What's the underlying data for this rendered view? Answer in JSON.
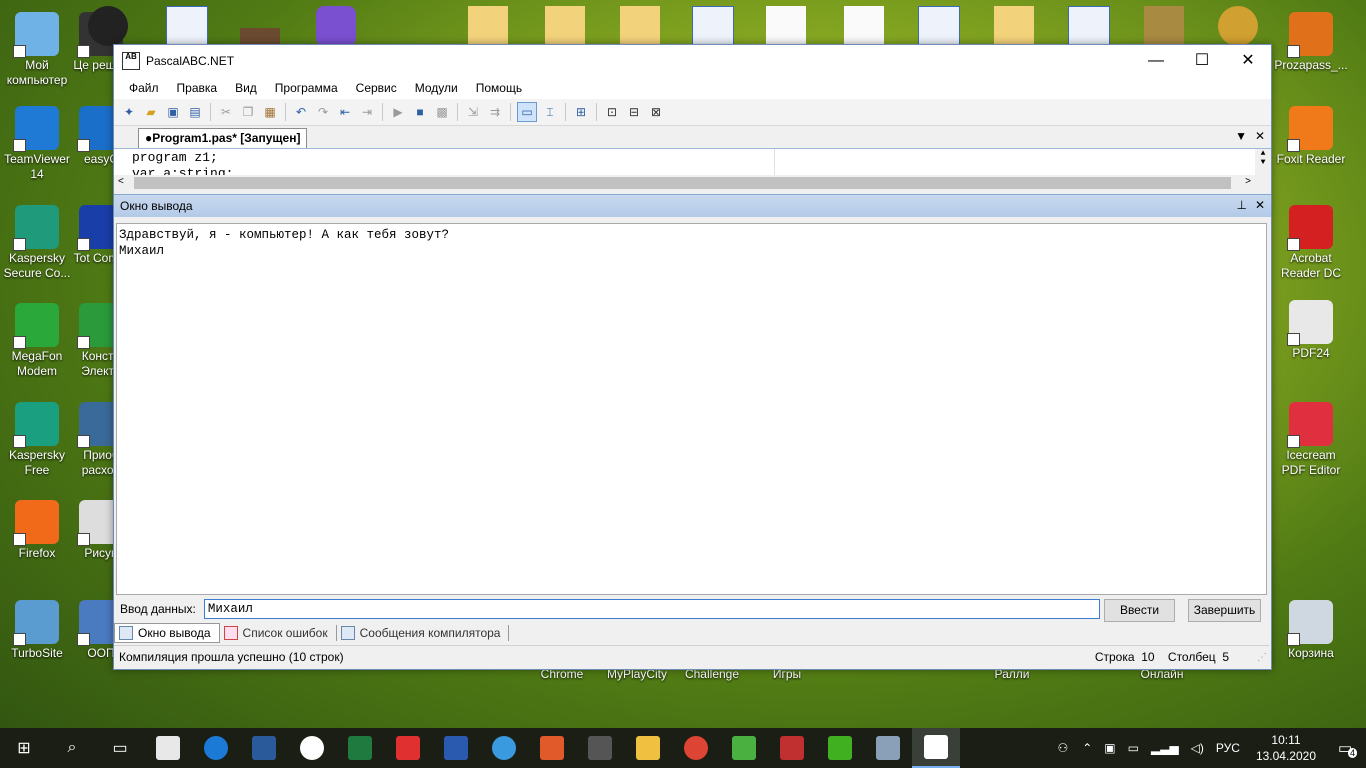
{
  "desktop": {
    "left_icons": [
      {
        "label": "Мой компьютер",
        "color": "#6fb3e6"
      },
      {
        "label": "TeamViewer 14",
        "color": "#1f7ad6"
      },
      {
        "label": "Kaspersky Secure Co...",
        "color": "#1f9a7a"
      },
      {
        "label": "MegaFon Modem",
        "color": "#2aa83a"
      },
      {
        "label": "Kaspersky Free",
        "color": "#1aa080"
      },
      {
        "label": "Firefox",
        "color": "#f06a1a"
      },
      {
        "label": "TurboSite",
        "color": "#5a9bd0"
      }
    ],
    "col2_icons": [
      {
        "label": "Це решен",
        "color": "#333333"
      },
      {
        "label": "easyC",
        "color": "#1a6fc9"
      },
      {
        "label": "Tot Comm",
        "color": "#1a3ea8"
      },
      {
        "label": "Констр Электр",
        "color": "#2a9a3a"
      },
      {
        "label": "Приоб расход",
        "color": "#3a6a9a"
      },
      {
        "label": "Рисун",
        "color": "#dddddd"
      },
      {
        "label": "ООП",
        "color": "#4a7ac0"
      }
    ],
    "right_icons": [
      {
        "label": "Prozapass_...",
        "color": "#e0701a"
      },
      {
        "label": "Foxit Reader",
        "color": "#f07a1a"
      },
      {
        "label": "Acrobat Reader DC",
        "color": "#d42020"
      },
      {
        "label": "PDF24",
        "color": "#e8e8e8"
      },
      {
        "label": "Icecream PDF Editor",
        "color": "#e03040"
      },
      {
        "label": "Корзина",
        "color": "#cfd8e0"
      }
    ],
    "bottom_labels": [
      "Chrome",
      "MyPlayCity",
      "Challenge",
      "Игры",
      "Ралли",
      "Онлайн"
    ]
  },
  "window": {
    "title": "PascalABC.NET",
    "icon_text": "AB",
    "controls": {
      "minimize": "—",
      "maximize": "☐",
      "close": "✕"
    },
    "menu": [
      "Файл",
      "Правка",
      "Вид",
      "Программа",
      "Сервис",
      "Модули",
      "Помощь"
    ],
    "file_tab": "●Program1.pas* [Запущен]",
    "editor_lines": [
      "program z1;",
      "var a:string;"
    ],
    "output_panel_title": "Окно вывода",
    "output_lines": [
      "Здравствуй, я - компьютер! А как тебя зовут?",
      "Михаил"
    ],
    "input_label": "Ввод данных:",
    "input_value": "Михаил",
    "enter_button": "Ввести",
    "finish_button": "Завершить",
    "bottom_tabs": [
      "Окно вывода",
      "Список ошибок",
      "Сообщения компилятора"
    ],
    "status_message": "Компиляция прошла успешно (10 строк)",
    "status_row_label": "Строка",
    "status_row_value": "10",
    "status_col_label": "Столбец",
    "status_col_value": "5"
  },
  "taskbar": {
    "language": "РУС",
    "time": "10:11",
    "date": "13.04.2020",
    "notifications": "4"
  }
}
